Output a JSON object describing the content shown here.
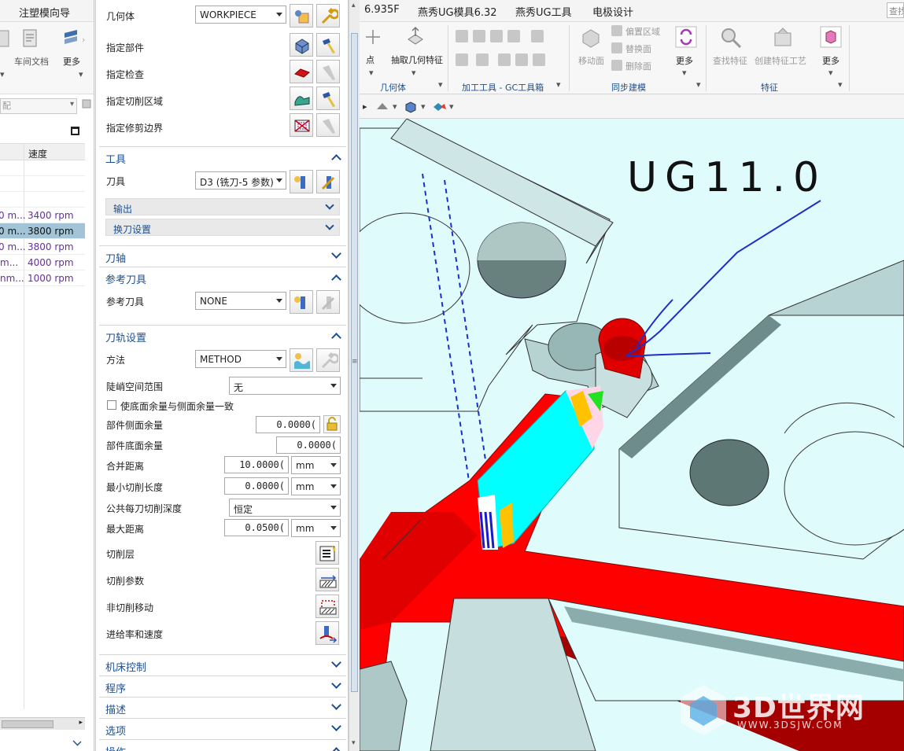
{
  "left_panel": {
    "menu_items": [
      "注塑模向导"
    ],
    "ribbon_labels": [
      "车间文档",
      "更多"
    ],
    "filter_placeholder": "配",
    "table": {
      "headers": [
        "速度"
      ],
      "rows": [
        {
          "prefix": "0 m...",
          "speed": "3400 rpm",
          "selected": false
        },
        {
          "prefix": "0 m...",
          "speed": "3800 rpm",
          "selected": true
        },
        {
          "prefix": "0 m...",
          "speed": "3800 rpm",
          "selected": false
        },
        {
          "prefix": "m...",
          "speed": "4000 rpm",
          "selected": false
        },
        {
          "prefix": "nm...",
          "speed": "1000 rpm",
          "selected": false
        }
      ]
    }
  },
  "dialog": {
    "geometry": {
      "geometry_label": "几何体",
      "geometry_value": "WORKPIECE",
      "specify_part": "指定部件",
      "specify_check": "指定检查",
      "specify_cut_area": "指定切削区域",
      "specify_trim": "指定修剪边界"
    },
    "tool_section": {
      "title": "工具",
      "tool_label": "刀具",
      "tool_value": "D3 (铣刀-5 参数)",
      "output": "输出",
      "tool_change": "换刀设置"
    },
    "axis_section": {
      "title": "刀轴"
    },
    "ref_tool_section": {
      "title": "参考刀具",
      "label": "参考刀具",
      "value": "NONE"
    },
    "path_section": {
      "title": "刀轨设置",
      "method_label": "方法",
      "method_value": "METHOD",
      "steep_label": "陡峭空间范围",
      "steep_value": "无",
      "same_stock_label": "使底面余量与侧面余量一致",
      "part_side_stock_label": "部件侧面余量",
      "part_side_stock_value": "0.0000(",
      "part_floor_stock_label": "部件底面余量",
      "part_floor_stock_value": "0.0000(",
      "merge_distance_label": "合并距离",
      "merge_distance_value": "10.0000(",
      "merge_distance_unit": "mm",
      "min_cut_length_label": "最小切削长度",
      "min_cut_length_value": "0.0000(",
      "min_cut_length_unit": "mm",
      "common_depth_label": "公共每刀切削深度",
      "common_depth_value": "恒定",
      "max_distance_label": "最大距离",
      "max_distance_value": "0.0500(",
      "max_distance_unit": "mm",
      "cut_levels": "切削层",
      "cut_params": "切削参数",
      "non_cut_moves": "非切削移动",
      "feeds_speeds": "进给率和速度"
    },
    "collapsed_sections": [
      "机床控制",
      "程序",
      "描述",
      "选项",
      "操作"
    ]
  },
  "main": {
    "menu_items": [
      "6.935F",
      "燕秀UG模具6.32",
      "燕秀UG工具",
      "电极设计"
    ],
    "search_placeholder": "查找",
    "ribbon": {
      "point_label": "点",
      "extract_geom": "抽取几何特征",
      "group_geometry": "几何体",
      "group_gc": "加工工具 - GC工具箱",
      "group_sync": "同步建模",
      "move_face": "移动面",
      "offset_region": "偏置区域",
      "replace_face": "替换面",
      "delete_face": "删除面",
      "more": "更多",
      "find_feature": "查找特征",
      "create_feature_process": "创建特征工艺",
      "group_feature": "特征"
    },
    "handwriting": "UG11.0",
    "watermark": {
      "title": "3D世界网",
      "url": "WWW.3DSJW.COM"
    }
  }
}
